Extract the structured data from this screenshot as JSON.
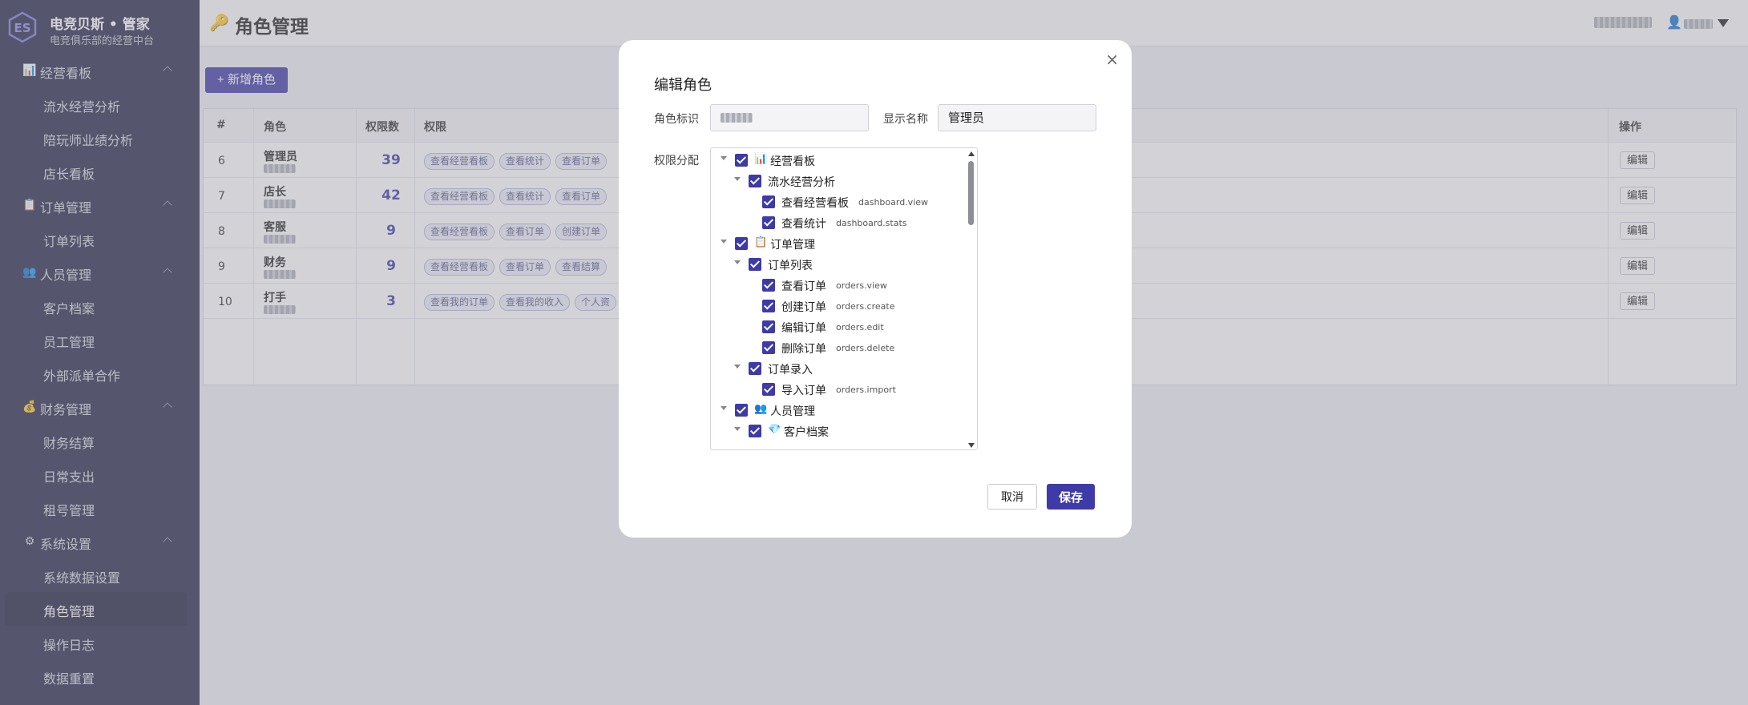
{
  "brand": {
    "title": "电竞贝斯 • 管家",
    "subtitle": "电竞俱乐部的经营中台"
  },
  "sidebar": {
    "groups": [
      {
        "label": "经营看板",
        "icon": "📊",
        "items": [
          "流水经营分析",
          "陪玩师业绩分析",
          "店长看板"
        ]
      },
      {
        "label": "订单管理",
        "icon": "📋",
        "items": [
          "订单列表"
        ]
      },
      {
        "label": "人员管理",
        "icon": "👥",
        "items": [
          "客户档案",
          "员工管理",
          "外部派单合作"
        ]
      },
      {
        "label": "财务管理",
        "icon": "💰",
        "items": [
          "财务结算",
          "日常支出",
          "租号管理"
        ]
      },
      {
        "label": "系统设置",
        "icon": "⚙",
        "items": [
          "系统数据设置",
          "角色管理",
          "操作日志",
          "数据重置"
        ]
      }
    ],
    "active_item": "角色管理"
  },
  "header": {
    "page_icon": "🔑",
    "page_title": "角色管理"
  },
  "toolbar": {
    "add_label": "+ 新增角色"
  },
  "table": {
    "columns": [
      "#",
      "角色",
      "权限数",
      "权限",
      "操作"
    ],
    "rows": [
      {
        "id": "6",
        "name": "管理员",
        "count": "39",
        "tags": [
          "查看经营看板",
          "查看统计",
          "查看订单"
        ],
        "action": "编辑"
      },
      {
        "id": "7",
        "name": "店长",
        "count": "42",
        "tags": [
          "查看经营看板",
          "查看统计",
          "查看订单"
        ],
        "action": "编辑"
      },
      {
        "id": "8",
        "name": "客服",
        "count": "9",
        "tags": [
          "查看经营看板",
          "查看订单",
          "创建订单"
        ],
        "action": "编辑"
      },
      {
        "id": "9",
        "name": "财务",
        "count": "9",
        "tags": [
          "查看经营看板",
          "查看订单",
          "查看结算"
        ],
        "action": "编辑"
      },
      {
        "id": "10",
        "name": "打手",
        "count": "3",
        "tags": [
          "查看我的订单",
          "查看我的收入",
          "个人资"
        ],
        "action": "编辑"
      }
    ]
  },
  "modal": {
    "title": "编辑角色",
    "role_key_label": "角色标识",
    "display_name_label": "显示名称",
    "display_name_value": "管理员",
    "permission_label": "权限分配",
    "cancel_label": "取消",
    "save_label": "保存",
    "close_glyph": "×",
    "tree": [
      {
        "level": 0,
        "label": "经营看板",
        "icon": "📊",
        "code": ""
      },
      {
        "level": 1,
        "label": "流水经营分析",
        "icon": "",
        "code": ""
      },
      {
        "level": 2,
        "label": "查看经营看板",
        "icon": "",
        "code": "dashboard.view"
      },
      {
        "level": 2,
        "label": "查看统计",
        "icon": "",
        "code": "dashboard.stats"
      },
      {
        "level": 0,
        "label": "订单管理",
        "icon": "📋",
        "code": ""
      },
      {
        "level": 1,
        "label": "订单列表",
        "icon": "",
        "code": ""
      },
      {
        "level": 2,
        "label": "查看订单",
        "icon": "",
        "code": "orders.view"
      },
      {
        "level": 2,
        "label": "创建订单",
        "icon": "",
        "code": "orders.create"
      },
      {
        "level": 2,
        "label": "编辑订单",
        "icon": "",
        "code": "orders.edit"
      },
      {
        "level": 2,
        "label": "删除订单",
        "icon": "",
        "code": "orders.delete"
      },
      {
        "level": 1,
        "label": "订单录入",
        "icon": "",
        "code": ""
      },
      {
        "level": 2,
        "label": "导入订单",
        "icon": "",
        "code": "orders.import"
      },
      {
        "level": 0,
        "label": "人员管理",
        "icon": "👥",
        "code": ""
      },
      {
        "level": 1,
        "label": "客户档案",
        "icon": "💎",
        "code": ""
      }
    ]
  },
  "colors": {
    "sidebar_bg": "#262849",
    "accent": "#3e3aa8"
  }
}
